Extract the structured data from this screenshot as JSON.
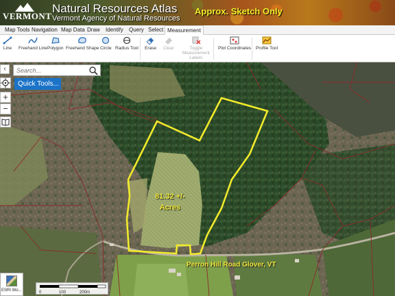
{
  "header": {
    "logo_text": "VERMONT",
    "title": "Natural Resources Atlas",
    "subtitle": "Vermont Agency of Natural Resources",
    "overlay_note": "Approx. Sketch Only"
  },
  "tabs": [
    {
      "label": "Map Tools",
      "active": false
    },
    {
      "label": "Navigation",
      "active": false
    },
    {
      "label": "Map Data",
      "active": false
    },
    {
      "label": "Draw",
      "active": false
    },
    {
      "label": "Identify",
      "active": false
    },
    {
      "label": "Query",
      "active": false
    },
    {
      "label": "Select",
      "active": false
    },
    {
      "label": "Measurement",
      "active": true
    }
  ],
  "ribbon": {
    "tools": [
      {
        "label": "Line",
        "icon": "line-icon",
        "enabled": true
      },
      {
        "label": "Freehand Line",
        "icon": "freehand-line-icon",
        "enabled": true
      },
      {
        "label": "Polygon",
        "icon": "polygon-icon",
        "enabled": true
      },
      {
        "label": "Freehand Shape",
        "icon": "freehand-shape-icon",
        "enabled": true
      },
      {
        "label": "Circle",
        "icon": "circle-icon",
        "enabled": true
      },
      {
        "label": "Radius Tool",
        "icon": "radius-icon",
        "enabled": true
      },
      {
        "label": "Erase",
        "icon": "eraser-icon",
        "enabled": true
      },
      {
        "label": "Clear",
        "icon": "clear-icon",
        "enabled": false
      },
      {
        "label": "Toggle",
        "label2": "Measurement",
        "label3": "Labels",
        "icon": "toggle-labels-icon",
        "enabled": false
      },
      {
        "label": "Plot Coordinates",
        "icon": "plot-coordinates-icon",
        "enabled": true
      },
      {
        "label": "Profile Tool",
        "icon": "profile-tool-icon",
        "enabled": true
      }
    ]
  },
  "map": {
    "back_arrow": "‹",
    "search_placeholder": "Search...",
    "quick_tools_label": "Quick Tools...",
    "zoom_in": "+",
    "zoom_out": "−",
    "parcel_label_line1": "81.32 +/-",
    "parcel_label_line2": "Acres",
    "road_label": "Perron Hill Road  Glover, VT",
    "parcel_outline_color": "#f2ea2c",
    "parcel_boundary_color": "#8b2a2a"
  },
  "footer": {
    "basemap_label": "ESRI Wo...",
    "scale_ticks": [
      "0",
      "100",
      "200m"
    ]
  }
}
